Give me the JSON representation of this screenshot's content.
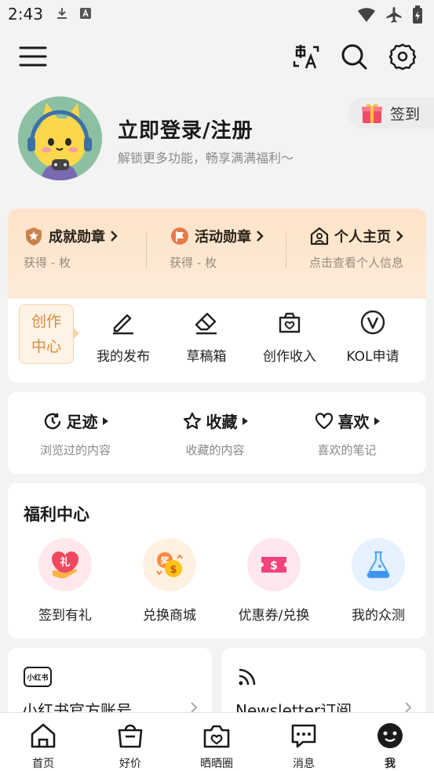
{
  "status_bar": {
    "time": "2:43"
  },
  "profile": {
    "login_title": "立即登录/注册",
    "login_subtitle": "解锁更多功能，畅享满满福利〜",
    "signin_label": "签到"
  },
  "badges": [
    {
      "title": "成就勋章",
      "sub": "获得 - 枚"
    },
    {
      "title": "活动勋章",
      "sub": "获得 - 枚"
    },
    {
      "title": "个人主页",
      "sub": "点击查看个人信息"
    }
  ],
  "creator": {
    "label_line1": "创作",
    "label_line2": "中心",
    "tools": [
      {
        "label": "我的发布",
        "icon": "edit-icon"
      },
      {
        "label": "草稿箱",
        "icon": "eraser-icon"
      },
      {
        "label": "创作收入",
        "icon": "income-bag-icon"
      },
      {
        "label": "KOL申请",
        "icon": "kol-v-icon"
      }
    ]
  },
  "history": [
    {
      "title": "足迹",
      "sub": "浏览过的内容",
      "icon": "history-icon"
    },
    {
      "title": "收藏",
      "sub": "收藏的内容",
      "icon": "star-icon"
    },
    {
      "title": "喜欢",
      "sub": "喜欢的笔记",
      "icon": "heart-icon"
    }
  ],
  "welfare": {
    "title": "福利中心",
    "items": [
      {
        "label": "签到有礼",
        "icon": "gift-heart-icon"
      },
      {
        "label": "兑换商城",
        "icon": "coin-exchange-icon"
      },
      {
        "label": "优惠券/兑换",
        "icon": "coupon-icon"
      },
      {
        "label": "我的众测",
        "icon": "flask-icon"
      }
    ]
  },
  "bottom_cards": [
    {
      "title": "小红书官方账号",
      "icon": "xiaohongshu-logo-icon",
      "logo_text": "小红书"
    },
    {
      "title": "Newsletter订阅",
      "icon": "rss-icon"
    }
  ],
  "tabs": [
    {
      "label": "首页",
      "icon": "home-icon"
    },
    {
      "label": "好价",
      "icon": "shopping-bag-icon"
    },
    {
      "label": "晒晒圈",
      "icon": "camera-heart-icon"
    },
    {
      "label": "消息",
      "icon": "chat-icon"
    },
    {
      "label": "我",
      "icon": "me-avatar-icon",
      "active": true
    }
  ],
  "colors": {
    "accent_orange": "#d9893e",
    "badge_bg": "#fde3c9",
    "page_bg": "#f3f3f3"
  }
}
